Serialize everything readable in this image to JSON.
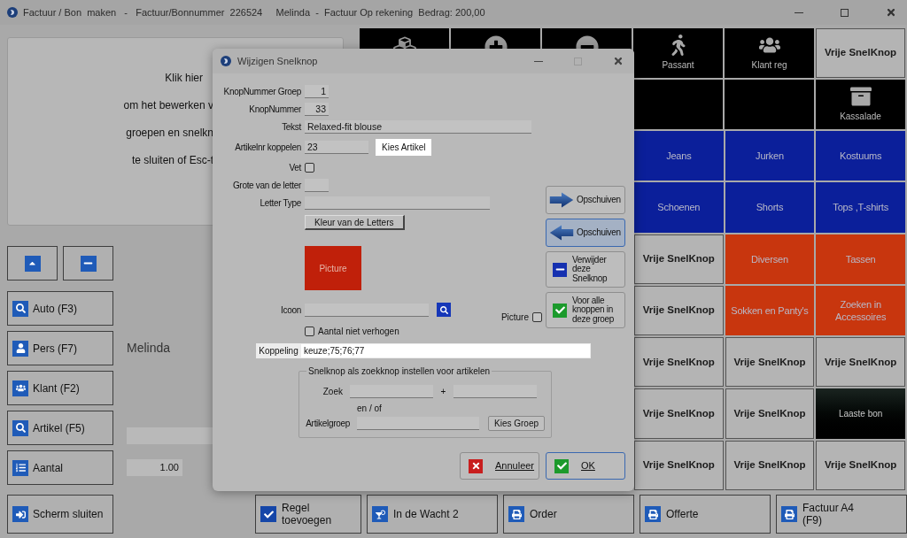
{
  "window": {
    "title": "Factuur / Bon  maken   -   Factuur/Bonnummer  226524     Melinda  -  Factuur Op rekening  Bedrag: 200,00"
  },
  "info_panel": {
    "lines": [
      "Klik hier",
      "om het bewerken v",
      "groepen en snelkn",
      "te sluiten of Esc-t"
    ]
  },
  "nav_buttons": [
    {
      "kind": "up"
    },
    {
      "kind": "minus"
    }
  ],
  "side_buttons": [
    {
      "label": "Auto (F3)",
      "kind": "search"
    },
    {
      "label": "Pers (F7)",
      "kind": "person"
    },
    {
      "label": "Klant (F2)",
      "kind": "people"
    },
    {
      "label": "Artikel (F5)",
      "kind": "search"
    },
    {
      "label": "Aantal",
      "kind": "list"
    }
  ],
  "customer": {
    "name": "Melinda"
  },
  "quantity": {
    "value": "1.00"
  },
  "close_button": {
    "label": "Scherm sluiten"
  },
  "tiles_top": [
    {
      "kind": "cubes"
    },
    {
      "kind": "plus"
    },
    {
      "kind": "minus"
    },
    {
      "kind": "walker",
      "label": "Passant"
    },
    {
      "kind": "group",
      "label": "Klant reg"
    },
    {
      "kind": "free",
      "label": "Vrije SnelKnop"
    }
  ],
  "tiles_second": [
    {
      "kind": "blank"
    },
    {
      "kind": "blank"
    },
    {
      "kind": "drawer",
      "label": "Kassalade"
    }
  ],
  "tiles": [
    {
      "kind": "category",
      "label": "Jeans",
      "color": "#0b1f9a"
    },
    {
      "kind": "category",
      "label": "Jurken",
      "color": "#0b1f9a"
    },
    {
      "kind": "category",
      "label": "Kostuums",
      "color": "#0b1f9a"
    },
    {
      "kind": "category",
      "label": "Schoenen",
      "color": "#0b1f9a"
    },
    {
      "kind": "category",
      "label": "Shorts",
      "color": "#0b1f9a"
    },
    {
      "kind": "category",
      "label": "Tops ,T-shirts",
      "color": "#0b1f9a"
    },
    {
      "kind": "free",
      "label": "Vrije SnelKnop"
    },
    {
      "kind": "category",
      "label": "Diversen",
      "color": "#c8360e"
    },
    {
      "kind": "category",
      "label": "Tassen",
      "color": "#c8360e"
    },
    {
      "kind": "free",
      "label": "Vrije SnelKnop"
    },
    {
      "kind": "category",
      "label": "Sokken en Panty's",
      "color": "#c8360e"
    },
    {
      "kind": "category",
      "label": "Zoeken in Accessoires",
      "color": "#c8360e"
    },
    {
      "kind": "free",
      "label": "Vrije SnelKnop"
    },
    {
      "kind": "free",
      "label": "Vrije SnelKnop"
    },
    {
      "kind": "free",
      "label": "Vrije SnelKnop"
    },
    {
      "kind": "free",
      "label": "Vrije SnelKnop"
    },
    {
      "kind": "free",
      "label": "Vrije SnelKnop"
    },
    {
      "kind": "dark",
      "label": "Laaste bon"
    },
    {
      "kind": "free",
      "label": "Vrije SnelKnop"
    },
    {
      "kind": "free",
      "label": "Vrije SnelKnop"
    },
    {
      "kind": "free",
      "label": "Vrije SnelKnop"
    }
  ],
  "bottom_buttons": [
    {
      "label": "Regel toevoegen",
      "kind": "check"
    },
    {
      "label": "In de Wacht 2",
      "kind": "glass"
    },
    {
      "label": "Order",
      "kind": "printer"
    },
    {
      "label": "Offerte",
      "kind": "printer"
    },
    {
      "label": "Factuur A4 (F9)",
      "kind": "printer"
    }
  ],
  "dialog": {
    "title": "Wijzigen Snelknop",
    "group_number": {
      "label": "KnopNummer Groep",
      "value": "1"
    },
    "button_number": {
      "label": "KnopNummer",
      "value": "33"
    },
    "text": {
      "label": "Tekst",
      "value": "Relaxed-fit blouse"
    },
    "article": {
      "label": "Artikelnr koppelen",
      "value": "23",
      "button": "Kies Artikel",
      "highlighted": true
    },
    "bold": {
      "label": "Vet",
      "checked": false
    },
    "font_size": {
      "label": "Grote van de letter"
    },
    "font_type": {
      "label": "Letter Type"
    },
    "color_button": {
      "label": "Kleur van de Letters"
    },
    "preview": {
      "label": "Picture",
      "color": "#c0200a"
    },
    "icon": {
      "label": "Icoon"
    },
    "picture": {
      "label": "Picture",
      "checked": false
    },
    "no_increase": {
      "label": "Aantal niet verhogen",
      "checked": false
    },
    "link": {
      "label": "Koppeling",
      "value": "keuze;75;76;77",
      "highlighted": true
    },
    "search_group": {
      "title": "Snelknop als zoekknop instellen voor artikelen",
      "search_label": "Zoek",
      "plus": "+",
      "or_label": "en / of",
      "group_label": "Artikelgroep",
      "group_button": "Kies Groep"
    },
    "side_buttons": [
      {
        "label": "Opschuiven",
        "kind": "right",
        "hovered": false
      },
      {
        "label": "Opschuiven",
        "kind": "left",
        "hovered": true
      },
      {
        "label": "Verwijder deze Snelknop",
        "kind": "remove",
        "hovered": false
      },
      {
        "label": "Voor alle knoppen in deze groep",
        "kind": "apply",
        "hovered": false
      }
    ],
    "buttons": [
      {
        "label": "Annuleer",
        "kind": "cancel",
        "focused": false
      },
      {
        "label": "OK",
        "kind": "ok",
        "focused": true
      }
    ]
  }
}
